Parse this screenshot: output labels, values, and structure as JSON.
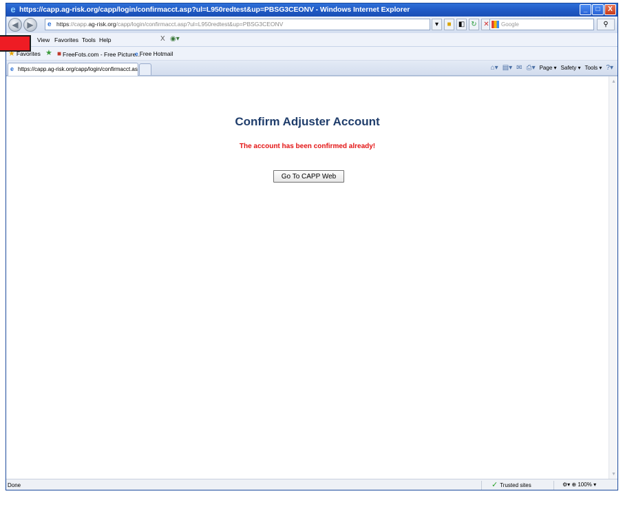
{
  "window": {
    "title": "https://capp.ag-risk.org/capp/login/confirmacct.asp?ul=L950redtest&up=PBSG3CEONV - Windows Internet Explorer",
    "buttons": {
      "minimize": "_",
      "maximize": "□",
      "close": "X"
    }
  },
  "address_bar": {
    "scheme": "https",
    "host_prefix": "://capp.",
    "host": "ag-risk.org",
    "path": "/capp/login/confirmacct.asp?ul=L950redtest&up=PBSG3CEONV",
    "search_placeholder": "Google"
  },
  "menu": {
    "items": [
      "View",
      "Favorites",
      "Tools",
      "Help"
    ],
    "extra": "X"
  },
  "favorites_bar": {
    "label": "Favorites",
    "items": [
      "FreeFots.com - Free Picture...",
      "Free Hotmail"
    ]
  },
  "tabs": [
    {
      "label": "https://capp.ag-risk.org/capp/login/confirmacct.asp?..."
    }
  ],
  "command_bar": {
    "page": "Page",
    "safety": "Safety",
    "tools": "Tools"
  },
  "page": {
    "title": "Confirm Adjuster Account",
    "message": "The account has been confirmed already!",
    "button_label": "Go To CAPP Web"
  },
  "status_bar": {
    "status": "Done",
    "zone": "Trusted sites",
    "zoom": "100%"
  },
  "colors": {
    "title_bar": "#1e57c2",
    "page_title": "#1f3d6b",
    "message": "#e31414",
    "redaction": "#ee1c24"
  }
}
